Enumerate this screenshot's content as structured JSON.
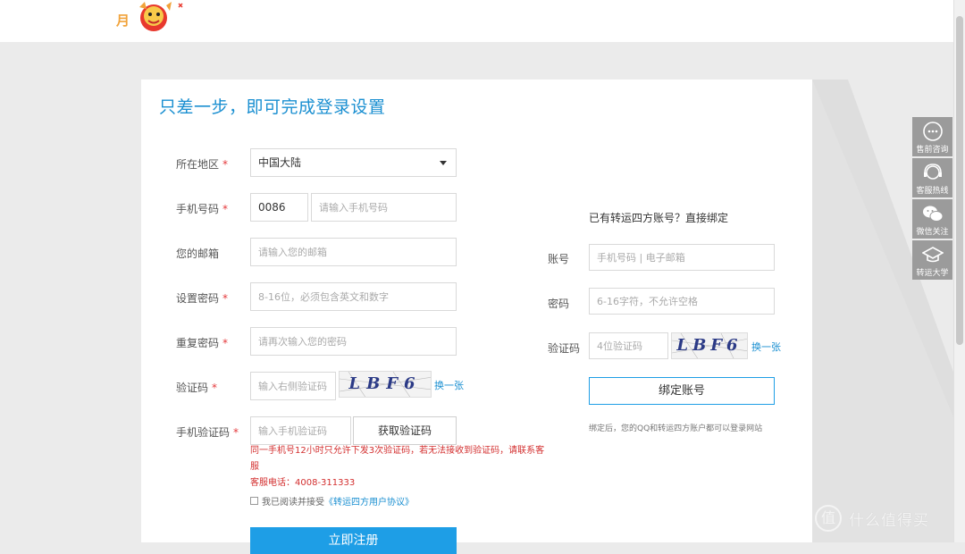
{
  "form": {
    "title": "只差一步，即可完成登录设置",
    "required_mark": "*",
    "region": {
      "label": "所在地区",
      "value": "中国大陆"
    },
    "phone": {
      "label": "手机号码",
      "code_value": "0086",
      "placeholder": "请输入手机号码"
    },
    "email": {
      "label": "您的邮箱",
      "placeholder": "请输入您的邮箱"
    },
    "password": {
      "label": "设置密码",
      "placeholder": "8-16位，必须包含英文和数字"
    },
    "confirm": {
      "label": "重复密码",
      "placeholder": "请再次输入您的密码"
    },
    "captcha": {
      "label": "验证码",
      "placeholder": "输入右侧验证码",
      "image_text": "LBF6",
      "refresh_label": "换一张"
    },
    "sms": {
      "label": "手机验证码",
      "placeholder": "输入手机验证码",
      "button_label": "获取验证码"
    },
    "warning_line1": "同一手机号12小时只允许下发3次验证码，若无法接收到验证码，请联系客服",
    "warning_line2": "客服电话：4008-311333",
    "agree_text": "我已阅读并接受",
    "agreement_link": "《转运四方用户协议》",
    "submit_label": "立即注册"
  },
  "bind": {
    "title": "已有转运四方账号？直接绑定",
    "account": {
      "label": "账号",
      "placeholder": "手机号码 | 电子邮箱"
    },
    "password": {
      "label": "密码",
      "placeholder": "6-16字符，不允许空格"
    },
    "captcha": {
      "label": "验证码",
      "placeholder": "4位验证码",
      "image_text": "LBF6",
      "refresh_label": "换一张"
    },
    "button_label": "绑定账号",
    "note": "绑定后，您的QQ和转运四方账户都可以登录网站"
  },
  "sidebar": [
    {
      "label": "售前咨询",
      "icon": "chat-bubble-icon"
    },
    {
      "label": "客服热线",
      "icon": "headset-icon"
    },
    {
      "label": "微信关注",
      "icon": "wechat-icon"
    },
    {
      "label": "转运大学",
      "icon": "graduation-cap-icon"
    }
  ],
  "logo": {
    "text": "月"
  },
  "watermark": {
    "text": "什么值得买",
    "icon": "值"
  },
  "colors": {
    "accent": "#1e9ee6",
    "title": "#1a8fd1",
    "warning": "#d32f2f",
    "sidebar": "#9b9b9b",
    "background": "#ebebeb"
  }
}
